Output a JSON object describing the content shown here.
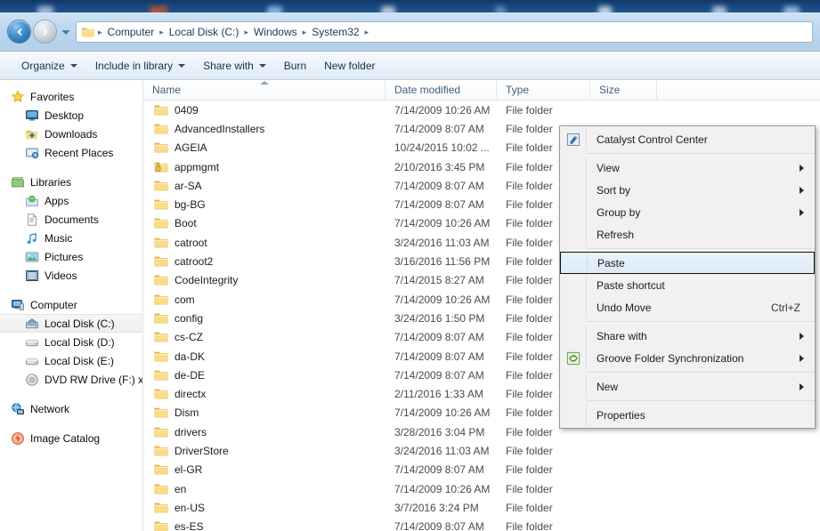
{
  "window": {
    "nav": {
      "back_icon": "back-arrow-icon",
      "forward_icon": "forward-arrow-icon",
      "history_icon": "history-dropdown-icon"
    },
    "address": {
      "folder_icon": "folder-icon",
      "separator": "▸",
      "crumbs": [
        "Computer",
        "Local Disk (C:)",
        "Windows",
        "System32"
      ]
    }
  },
  "toolbar": {
    "items": [
      {
        "label": "Organize",
        "has_caret": true
      },
      {
        "label": "Include in library",
        "has_caret": true
      },
      {
        "label": "Share with",
        "has_caret": true
      },
      {
        "label": "Burn",
        "has_caret": false
      },
      {
        "label": "New folder",
        "has_caret": false
      }
    ]
  },
  "sidebar": {
    "groups": [
      {
        "root": {
          "label": "Favorites",
          "icon": "star-icon"
        },
        "items": [
          {
            "label": "Desktop",
            "icon": "desktop-icon"
          },
          {
            "label": "Downloads",
            "icon": "downloads-icon"
          },
          {
            "label": "Recent Places",
            "icon": "recent-places-icon"
          }
        ]
      },
      {
        "root": {
          "label": "Libraries",
          "icon": "libraries-icon"
        },
        "items": [
          {
            "label": "Apps",
            "icon": "apps-icon"
          },
          {
            "label": "Documents",
            "icon": "documents-icon"
          },
          {
            "label": "Music",
            "icon": "music-icon"
          },
          {
            "label": "Pictures",
            "icon": "pictures-icon"
          },
          {
            "label": "Videos",
            "icon": "videos-icon"
          }
        ]
      },
      {
        "root": {
          "label": "Computer",
          "icon": "computer-icon"
        },
        "items": [
          {
            "label": "Local Disk (C:)",
            "icon": "system-drive-icon",
            "selected": true
          },
          {
            "label": "Local Disk (D:)",
            "icon": "drive-icon"
          },
          {
            "label": "Local Disk (E:)",
            "icon": "drive-icon"
          },
          {
            "label": "DVD RW Drive (F:) xx",
            "icon": "dvd-drive-icon"
          }
        ]
      },
      {
        "root": {
          "label": "Network",
          "icon": "network-icon"
        },
        "items": []
      },
      {
        "root": {
          "label": "Image Catalog",
          "icon": "image-catalog-icon"
        },
        "items": []
      }
    ]
  },
  "file_list": {
    "columns": [
      {
        "label": "Name",
        "sorted": true,
        "sort_direction": "ascending"
      },
      {
        "label": "Date modified",
        "sorted": false
      },
      {
        "label": "Type",
        "sorted": false
      },
      {
        "label": "Size",
        "sorted": false
      }
    ],
    "rows": [
      {
        "name": "0409",
        "date": "7/14/2009 10:26 AM",
        "type": "File folder",
        "size": "",
        "icon": "folder-icon"
      },
      {
        "name": "AdvancedInstallers",
        "date": "7/14/2009 8:07 AM",
        "type": "File folder",
        "size": "",
        "icon": "folder-icon"
      },
      {
        "name": "AGEIA",
        "date": "10/24/2015 10:02 ...",
        "type": "File folder",
        "size": "",
        "icon": "folder-icon"
      },
      {
        "name": "appmgmt",
        "date": "2/10/2016 3:45 PM",
        "type": "File folder",
        "size": "",
        "icon": "locked-folder-icon"
      },
      {
        "name": "ar-SA",
        "date": "7/14/2009 8:07 AM",
        "type": "File folder",
        "size": "",
        "icon": "folder-icon"
      },
      {
        "name": "bg-BG",
        "date": "7/14/2009 8:07 AM",
        "type": "File folder",
        "size": "",
        "icon": "folder-icon"
      },
      {
        "name": "Boot",
        "date": "7/14/2009 10:26 AM",
        "type": "File folder",
        "size": "",
        "icon": "folder-icon"
      },
      {
        "name": "catroot",
        "date": "3/24/2016 11:03 AM",
        "type": "File folder",
        "size": "",
        "icon": "folder-icon"
      },
      {
        "name": "catroot2",
        "date": "3/16/2016 11:56 PM",
        "type": "File folder",
        "size": "",
        "icon": "folder-icon"
      },
      {
        "name": "CodeIntegrity",
        "date": "7/14/2015 8:27 AM",
        "type": "File folder",
        "size": "",
        "icon": "folder-icon"
      },
      {
        "name": "com",
        "date": "7/14/2009 10:26 AM",
        "type": "File folder",
        "size": "",
        "icon": "folder-icon"
      },
      {
        "name": "config",
        "date": "3/24/2016 1:50 PM",
        "type": "File folder",
        "size": "",
        "icon": "folder-icon"
      },
      {
        "name": "cs-CZ",
        "date": "7/14/2009 8:07 AM",
        "type": "File folder",
        "size": "",
        "icon": "folder-icon"
      },
      {
        "name": "da-DK",
        "date": "7/14/2009 8:07 AM",
        "type": "File folder",
        "size": "",
        "icon": "folder-icon"
      },
      {
        "name": "de-DE",
        "date": "7/14/2009 8:07 AM",
        "type": "File folder",
        "size": "",
        "icon": "folder-icon"
      },
      {
        "name": "directx",
        "date": "2/11/2016 1:33 AM",
        "type": "File folder",
        "size": "",
        "icon": "folder-icon"
      },
      {
        "name": "Dism",
        "date": "7/14/2009 10:26 AM",
        "type": "File folder",
        "size": "",
        "icon": "folder-icon"
      },
      {
        "name": "drivers",
        "date": "3/28/2016 3:04 PM",
        "type": "File folder",
        "size": "",
        "icon": "folder-icon"
      },
      {
        "name": "DriverStore",
        "date": "3/24/2016 11:03 AM",
        "type": "File folder",
        "size": "",
        "icon": "folder-icon"
      },
      {
        "name": "el-GR",
        "date": "7/14/2009 8:07 AM",
        "type": "File folder",
        "size": "",
        "icon": "folder-icon"
      },
      {
        "name": "en",
        "date": "7/14/2009 10:26 AM",
        "type": "File folder",
        "size": "",
        "icon": "folder-icon"
      },
      {
        "name": "en-US",
        "date": "3/7/2016 3:24 PM",
        "type": "File folder",
        "size": "",
        "icon": "folder-icon"
      },
      {
        "name": "es-ES",
        "date": "7/14/2009 8:07 AM",
        "type": "File folder",
        "size": "",
        "icon": "folder-icon"
      }
    ]
  },
  "context_menu": {
    "items": [
      {
        "kind": "item",
        "label": "Catalyst Control Center",
        "icon": "catalyst-control-center-icon",
        "accel": "",
        "submenu": false
      },
      {
        "kind": "separator"
      },
      {
        "kind": "item",
        "label": "View",
        "icon": "",
        "accel": "",
        "submenu": true
      },
      {
        "kind": "item",
        "label": "Sort by",
        "icon": "",
        "accel": "",
        "submenu": true
      },
      {
        "kind": "item",
        "label": "Group by",
        "icon": "",
        "accel": "",
        "submenu": true
      },
      {
        "kind": "item",
        "label": "Refresh",
        "icon": "",
        "accel": "",
        "submenu": false
      },
      {
        "kind": "separator"
      },
      {
        "kind": "item",
        "label": "Paste",
        "icon": "",
        "accel": "",
        "submenu": false,
        "selected": true
      },
      {
        "kind": "item",
        "label": "Paste shortcut",
        "icon": "",
        "accel": "",
        "submenu": false
      },
      {
        "kind": "item",
        "label": "Undo Move",
        "icon": "",
        "accel": "Ctrl+Z",
        "submenu": false
      },
      {
        "kind": "separator"
      },
      {
        "kind": "item",
        "label": "Share with",
        "icon": "",
        "accel": "",
        "submenu": true
      },
      {
        "kind": "item",
        "label": "Groove Folder Synchronization",
        "icon": "groove-sync-icon",
        "accel": "",
        "submenu": true
      },
      {
        "kind": "separator"
      },
      {
        "kind": "item",
        "label": "New",
        "icon": "",
        "accel": "",
        "submenu": true
      },
      {
        "kind": "separator"
      },
      {
        "kind": "item",
        "label": "Properties",
        "icon": "",
        "accel": "",
        "submenu": false
      }
    ]
  },
  "colors": {
    "titlebar": "#bed8ef",
    "accent_blue": "#1b5f9e",
    "folder_yellow": "#f5cf6b",
    "selection_blue": "#dcebf8",
    "menu_bg": "#f1f1f1",
    "desktop_blue": "#17467c"
  }
}
